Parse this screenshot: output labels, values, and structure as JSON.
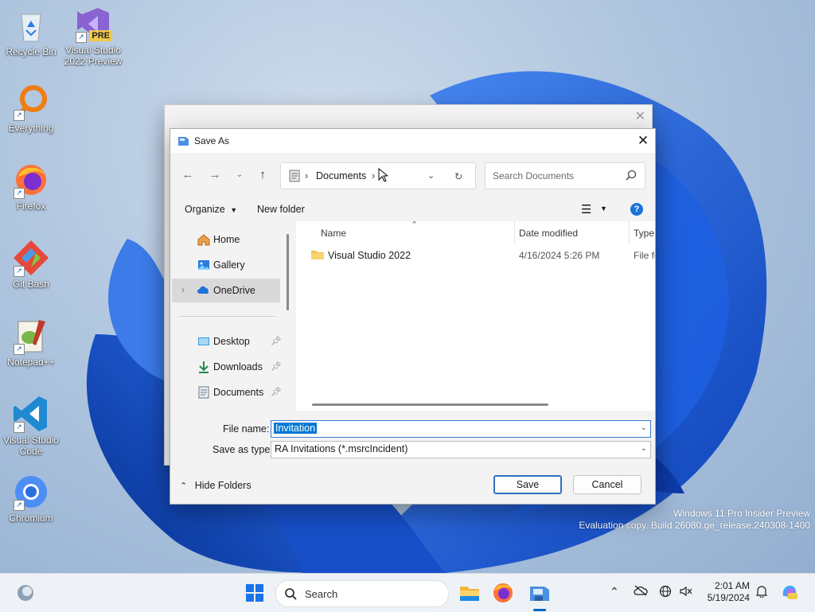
{
  "desktop": {
    "icons": [
      {
        "label_line1": "Recycle Bin",
        "label_line2": ""
      },
      {
        "label_line1": "Visual Studio",
        "label_line2": "2022 Preview",
        "badge": "PRE"
      },
      {
        "label_line1": "Everything",
        "label_line2": ""
      },
      {
        "label_line1": "Firefox",
        "label_line2": ""
      },
      {
        "label_line1": "Git Bash",
        "label_line2": ""
      },
      {
        "label_line1": "Notepad++",
        "label_line2": ""
      },
      {
        "label_line1": "Visual Studio",
        "label_line2": "Code"
      },
      {
        "label_line1": "Chromium",
        "label_line2": ""
      }
    ],
    "watermark_line1": "Windows 11 Pro Insider Preview",
    "watermark_line2": "Evaluation copy. Build 26080.ge_release.240308-1400"
  },
  "dialog": {
    "title": "Save As",
    "address": {
      "crumb": "Documents"
    },
    "search_placeholder": "Search Documents",
    "commands": {
      "organize": "Organize",
      "new_folder": "New folder"
    },
    "nav": [
      {
        "label": "Home"
      },
      {
        "label": "Gallery"
      },
      {
        "label": "OneDrive"
      },
      {
        "label": "Desktop"
      },
      {
        "label": "Downloads"
      },
      {
        "label": "Documents"
      }
    ],
    "columns": {
      "name": "Name",
      "date": "Date modified",
      "type": "Type"
    },
    "files": [
      {
        "name": "Visual Studio 2022",
        "date": "4/16/2024 5:26 PM",
        "type": "File fo"
      }
    ],
    "file_name_label": "File name:",
    "file_name_value": "Invitation",
    "save_type_label": "Save as type:",
    "save_type_value": "RA Invitations (*.msrcIncident)",
    "hide_folders": "Hide Folders",
    "save_button": "Save",
    "cancel_button": "Cancel"
  },
  "taskbar": {
    "search_label": "Search",
    "time": "2:01 AM",
    "date": "5/19/2024",
    "accent": "#0067c0"
  }
}
